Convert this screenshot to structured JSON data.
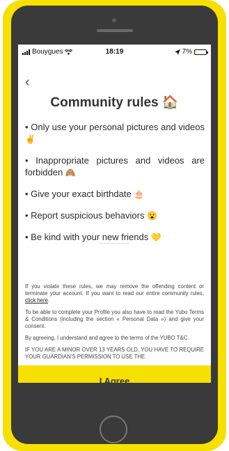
{
  "status_bar": {
    "carrier": "Bouygues",
    "time": "18:19",
    "battery": "7%",
    "battery_level": 0.07,
    "icons": [
      "signal-bars-icon",
      "wifi-icon",
      "location-arrow-icon",
      "battery-icon"
    ]
  },
  "header": {
    "back_icon": "‹",
    "title": "Community rules",
    "title_icon": "🏠"
  },
  "rules": [
    {
      "text": "• Only use your personal pictures and videos",
      "icon": "✌️"
    },
    {
      "text": "• Inappropriate pictures and videos are forbidden",
      "icon": "🙈"
    },
    {
      "text": "• Give your exact birthdate",
      "icon": "🎂"
    },
    {
      "text": "• Report suspicious behaviors",
      "icon": "😮"
    },
    {
      "text": "• Be kind with your new friends",
      "icon": "💛"
    }
  ],
  "legal": {
    "p1_text": "If you violate these rules, we may remove the offending content or terminate your account. If you want to read our entire community rules, ",
    "p1_link": "click here",
    "p1_end": ".",
    "p2": "To be able to complete your Profile you also have to read the Yubo Terms & Conditions (including the section « Personal Data ») and give your consent.",
    "p3": "By agreeing, I understand and agree to the terms of the YUBO T&C.",
    "p4": "IF YOU ARE A MINOR OVER 13 YEARS OLD, YOU HAVE TO REQUIRE YOUR GUARDIAN'S PERMISSION TO USE THE"
  },
  "actions": {
    "agree_label": "I Agree"
  },
  "colors": {
    "accent": "#f6e000",
    "device_body": "#3a3a3a"
  }
}
